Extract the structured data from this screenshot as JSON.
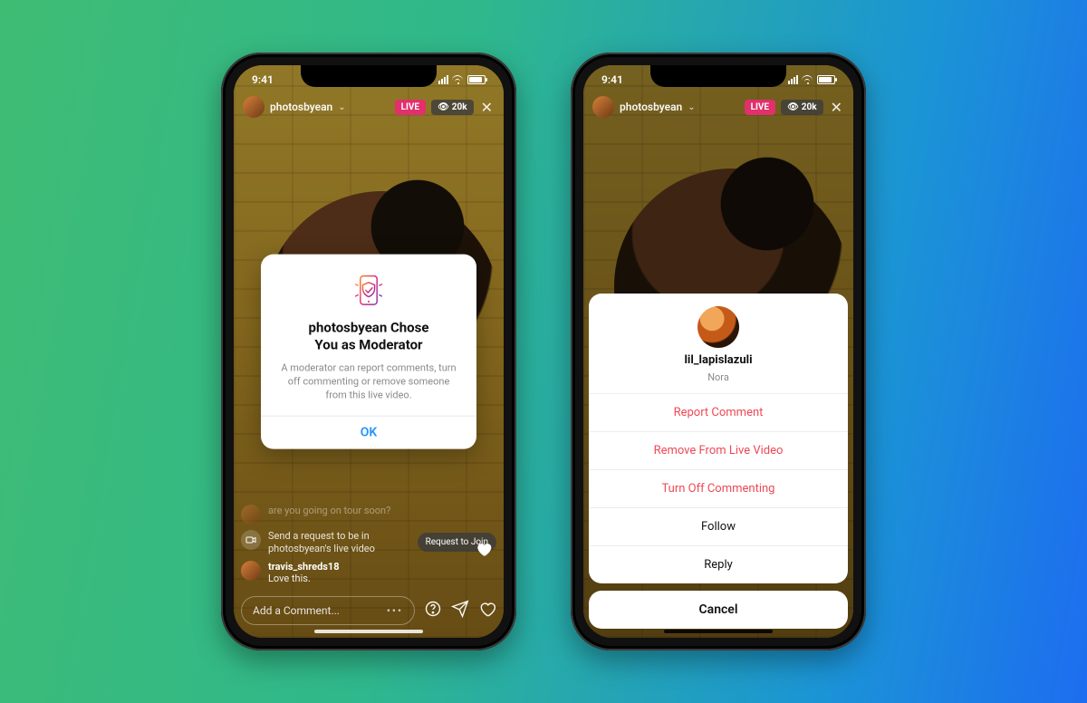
{
  "status": {
    "time": "9:41"
  },
  "live": {
    "username": "photosbyean",
    "live_label": "LIVE",
    "viewer_count": "20k"
  },
  "phone1": {
    "modal": {
      "title_line1": "photosbyean Chose",
      "title_line2": "You as Moderator",
      "body": "A moderator can report comments, turn off commenting or remove someone from this live video.",
      "ok": "OK"
    },
    "comments": {
      "q_text": "are you going on tour soon?",
      "join_line1": "Send a request to be in",
      "join_line2": "photosbyean's live video",
      "join_button": "Request to Join",
      "c_user": "travis_shreds18",
      "c_text": "Love this."
    },
    "input_placeholder": "Add a Comment..."
  },
  "phone2": {
    "sheet": {
      "username": "lil_lapislazuli",
      "displayname": "Nora",
      "report": "Report Comment",
      "remove": "Remove From Live Video",
      "turnoff": "Turn Off Commenting",
      "follow": "Follow",
      "reply": "Reply",
      "cancel": "Cancel"
    }
  }
}
